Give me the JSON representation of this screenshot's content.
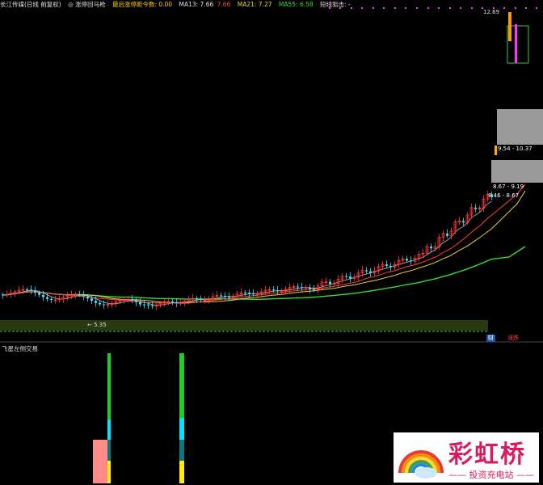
{
  "header": {
    "stock": "长江传媒(日线 前复权)",
    "indicator": "◎ 涨停回马枪",
    "last_limit_days_label": "最后涨停距今数: 0.00",
    "ma13": "MA13: 7.66",
    "ma_extra": "7.66",
    "ma21": "MA21: 7.27",
    "ma55": "MA55: 6.58",
    "short_track": "短线狙击: -"
  },
  "labels": {
    "high_price": "12.69",
    "low_price": "← 5.35",
    "zone1": "9.54 - 10.37",
    "zone2": "8.67 - 9.19",
    "zone3": "8.46 - 8.67",
    "cai": "财",
    "fu": "涨跌"
  },
  "lower": {
    "title": "飞星左侧交易"
  },
  "logo": {
    "brand": "彩虹桥",
    "tagline": "—— 投资充电站 ——"
  },
  "colors": {
    "up": "#ff3b3b",
    "down": "#3fe0ff",
    "ma13": "#ff4040",
    "ma21": "#e8d040",
    "ma55": "#33dd33",
    "zone": "#9a9a9a"
  }
}
